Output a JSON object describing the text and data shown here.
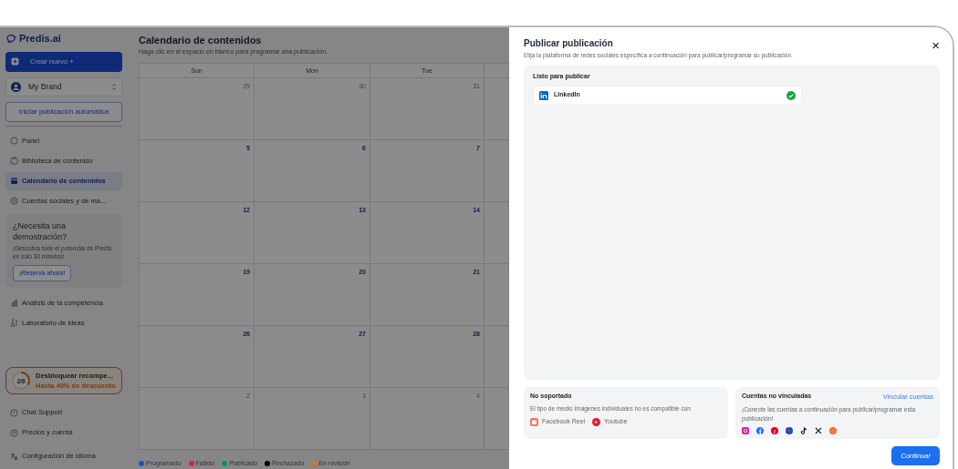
{
  "sidebar": {
    "logo": "Predis.ai",
    "create_button": "Crear nuevo +",
    "brand_select": "My Brand",
    "autopublish_button": "Iniciar publicación automática",
    "items": [
      {
        "label": "Panel",
        "selected": false
      },
      {
        "label": "Biblioteca de contenido",
        "selected": false
      },
      {
        "label": "Calendario de contenidos",
        "selected": true
      },
      {
        "label": "Cuentas sociales y de ma...",
        "selected": false
      }
    ],
    "demo_card": {
      "title": "¿Necesita una demostración?",
      "text": "¡Descubra todo el potencial de Predis en sólo 30 minutos!",
      "button": "¡Reserva ahora!"
    },
    "items_2": [
      {
        "label": "Análisis de la competencia",
        "selected": false
      },
      {
        "label": "Laboratorio de ideas",
        "selected": false
      }
    ],
    "rewards": {
      "progress": "2/6",
      "level": 0.33,
      "title": "Desbloquear recompe...",
      "subtitle": "Hasta 40% de descuento"
    },
    "footer_items": [
      {
        "label": "Chat Support"
      },
      {
        "label": "Precios y cuenta"
      },
      {
        "label": "Configuración de idioma"
      }
    ]
  },
  "calendar": {
    "title": "Calendario de contenidos",
    "subtitle": "Haga clic en el espacio en blanco para programar una publicación.",
    "days": [
      "Sun",
      "Mon",
      "Tue"
    ],
    "weeks": [
      [
        {
          "day": "29",
          "outside": true
        },
        {
          "day": "30",
          "outside": true
        },
        {
          "day": "31",
          "outside": true
        }
      ],
      [
        {
          "day": "5",
          "outside": false
        },
        {
          "day": "6",
          "outside": false
        },
        {
          "day": "7",
          "outside": false
        }
      ],
      [
        {
          "day": "12",
          "outside": false
        },
        {
          "day": "13",
          "outside": false
        },
        {
          "day": "14",
          "outside": false
        }
      ],
      [
        {
          "day": "19",
          "outside": false
        },
        {
          "day": "20",
          "outside": false
        },
        {
          "day": "21",
          "outside": false
        }
      ],
      [
        {
          "day": "26",
          "outside": false
        },
        {
          "day": "27",
          "outside": false
        },
        {
          "day": "28",
          "outside": false
        }
      ],
      [
        {
          "day": "2",
          "outside": true
        },
        {
          "day": "3",
          "outside": true
        },
        {
          "day": "4",
          "outside": true
        }
      ]
    ],
    "legend": [
      {
        "label": "Programado",
        "color": "#1d4ed8"
      },
      {
        "label": "Fallido",
        "color": "#e11d48"
      },
      {
        "label": "Publicado",
        "color": "#059669"
      },
      {
        "label": "Rechazado",
        "color": "#000000"
      },
      {
        "label": "En revisión",
        "color": "#d97706"
      }
    ]
  },
  "modal": {
    "title": "Publicar publicación",
    "close": "×",
    "subtitle": "Elija la plataforma de redes sociales específica a continuación para publicar/programar su publicación.",
    "ready_title": "Listo para publicar",
    "ready": [
      {
        "name": "LinkedIn",
        "checked": true
      }
    ],
    "unsupported": {
      "title": "No soportado",
      "text": "El tipo de medio Imágenes individuales no es compatible con",
      "platforms": [
        {
          "name": "Facebook Reel",
          "kind": "reel"
        },
        {
          "name": "Youtube",
          "kind": "youtube"
        }
      ]
    },
    "unlinked": {
      "title": "Cuentas no vinculadas",
      "link": "Vincular cuentas",
      "text": "¡Conecte las cuentas a continuación para publicar/programar esta publicación!"
    },
    "continue_button": "Continuar"
  }
}
